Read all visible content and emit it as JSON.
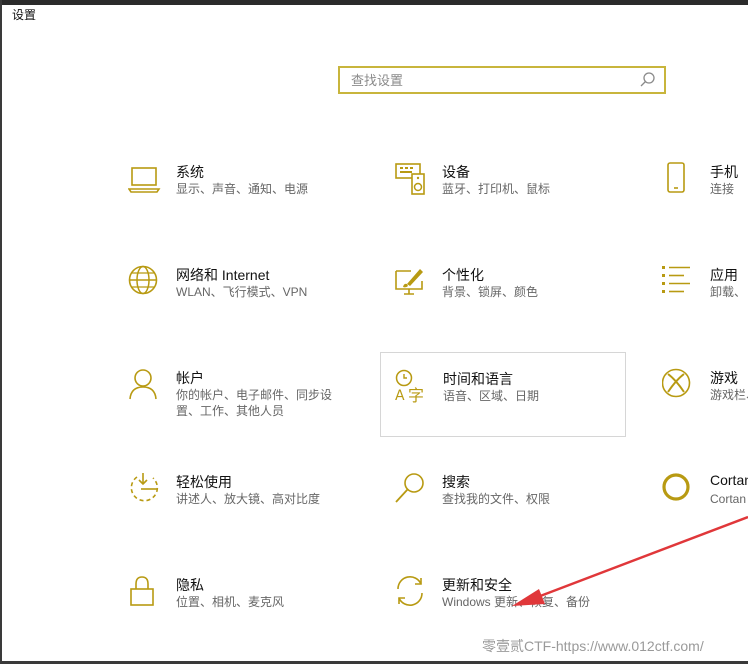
{
  "window": {
    "title": "设置"
  },
  "search": {
    "placeholder": "查找设置"
  },
  "tiles": [
    {
      "title": "系统",
      "desc": "显示、声音、通知、电源",
      "icon": "laptop-icon"
    },
    {
      "title": "设备",
      "desc": "蓝牙、打印机、鼠标",
      "icon": "devices-icon"
    },
    {
      "title": "手机",
      "desc": "连接",
      "icon": "phone-icon"
    },
    {
      "title": "网络和 Internet",
      "desc": "WLAN、飞行模式、VPN",
      "icon": "globe-icon"
    },
    {
      "title": "个性化",
      "desc": "背景、锁屏、颜色",
      "icon": "personalization-icon"
    },
    {
      "title": "应用",
      "desc": "卸载、",
      "icon": "apps-icon"
    },
    {
      "title": "帐户",
      "desc": "你的帐户、电子邮件、同步设",
      "desc2": "置、工作、其他人员",
      "icon": "person-icon"
    },
    {
      "title": "时间和语言",
      "desc": "语音、区域、日期",
      "icon": "time-language-icon"
    },
    {
      "title": "游戏",
      "desc": "游戏栏、",
      "icon": "xbox-icon"
    },
    {
      "title": "轻松使用",
      "desc": "讲述人、放大镜、高对比度",
      "icon": "ease-of-access-icon"
    },
    {
      "title": "搜索",
      "desc": "查找我的文件、权限",
      "icon": "search-icon"
    },
    {
      "title": "Cortan",
      "desc": "Cortan",
      "icon": "cortana-icon"
    },
    {
      "title": "隐私",
      "desc": "位置、相机、麦克风",
      "icon": "lock-icon"
    },
    {
      "title": "更新和安全",
      "desc": "Windows 更新、恢复、备份",
      "icon": "sync-icon"
    }
  ],
  "watermark": "零壹贰CTF-https://www.012ctf.com/",
  "colors": {
    "accent": "#c8b53c",
    "icon": "#b89a12",
    "arrow": "#e0373a"
  }
}
